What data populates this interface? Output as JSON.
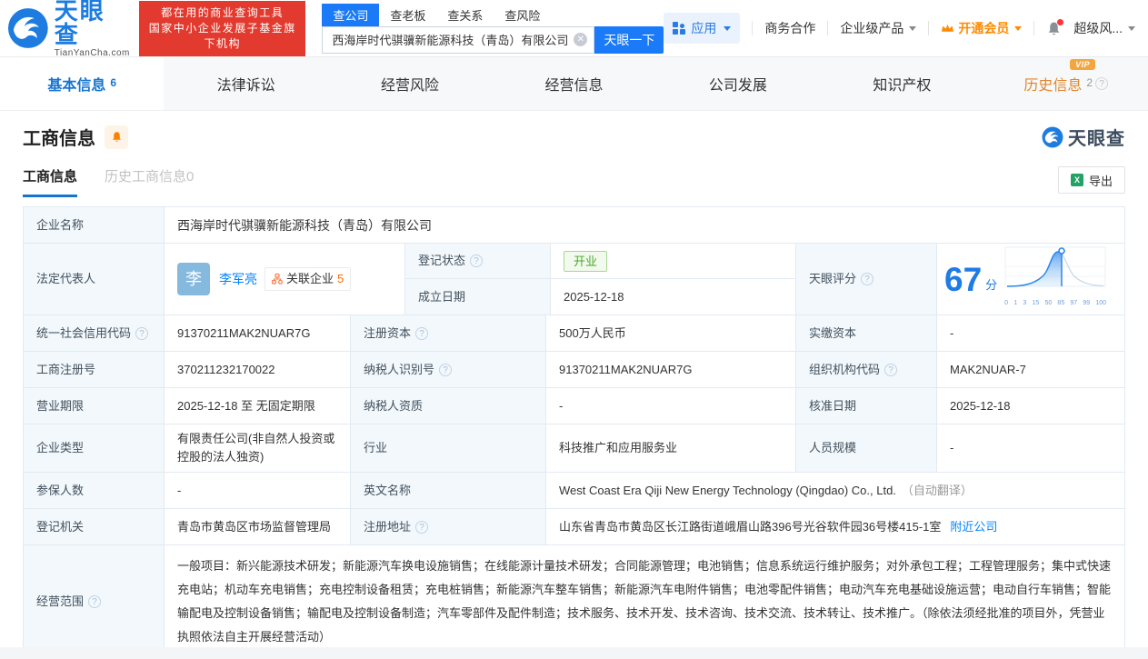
{
  "header": {
    "logo_title": "天眼查",
    "logo_domain": "TianYanCha.com",
    "slogan_line1": "都在用的商业查询工具",
    "slogan_line2": "国家中小企业发展子基金旗下机构",
    "search_tabs": {
      "company": "查公司",
      "boss": "查老板",
      "relation": "查关系",
      "risk": "查风险"
    },
    "search_value": "西海岸时代骐骥新能源科技（青岛）有限公司",
    "search_button": "天眼一下",
    "nav": {
      "apps": "应用",
      "cooperation": "商务合作",
      "enterprise": "企业级产品",
      "vip": "开通会员",
      "super_risk": "超级风..."
    }
  },
  "tabs": {
    "basic": "基本信息",
    "basic_count": "6",
    "legal": "法律诉讼",
    "biz_risk": "经营风险",
    "biz_info": "经营信息",
    "development": "公司发展",
    "ip": "知识产权",
    "history": "历史信息",
    "history_count": "2",
    "vip_badge": "VIP"
  },
  "section": {
    "title": "工商信息",
    "subtab_current": "工商信息",
    "subtab_history": "历史工商信息0",
    "export_label": "导出",
    "watermark": "天眼查"
  },
  "info": {
    "company_name_label": "企业名称",
    "company_name": "西海岸时代骐骥新能源科技（青岛）有限公司",
    "legal_rep_label": "法定代表人",
    "avatar_char": "李",
    "legal_rep_name": "李军亮",
    "related_label": "关联企业",
    "related_count": "5",
    "reg_status_label": "登记状态",
    "reg_status": "开业",
    "establish_label": "成立日期",
    "establish_date": "2025-12-18",
    "score_label": "天眼评分",
    "score": "67",
    "score_unit": "分",
    "score_ticks": [
      "0",
      "1",
      "3",
      "15",
      "50",
      "85",
      "97",
      "99",
      "100"
    ],
    "uscc_label": "统一社会信用代码",
    "uscc": "91370211MAK2NUAR7G",
    "reg_capital_label": "注册资本",
    "reg_capital": "500万人民币",
    "paid_capital_label": "实缴资本",
    "paid_capital": "-",
    "reg_number_label": "工商注册号",
    "reg_number": "370211232170022",
    "taxpayer_id_label": "纳税人识别号",
    "taxpayer_id": "91370211MAK2NUAR7G",
    "org_code_label": "组织机构代码",
    "org_code": "MAK2NUAR-7",
    "term_label": "营业期限",
    "term": "2025-12-18 至 无固定期限",
    "taxpayer_quality_label": "纳税人资质",
    "taxpayer_quality": "-",
    "approval_date_label": "核准日期",
    "approval_date": "2025-12-18",
    "company_type_label": "企业类型",
    "company_type": "有限责任公司(非自然人投资或控股的法人独资)",
    "industry_label": "行业",
    "industry": "科技推广和应用服务业",
    "staff_size_label": "人员规模",
    "staff_size": "-",
    "insured_label": "参保人数",
    "insured": "-",
    "english_name_label": "英文名称",
    "english_name": "West Coast Era Qiji New Energy Technology (Qingdao) Co., Ltd.",
    "auto_translate": "（自动翻译）",
    "authority_label": "登记机关",
    "authority": "青岛市黄岛区市场监督管理局",
    "address_label": "注册地址",
    "address": "山东省青岛市黄岛区长江路街道峨眉山路396号光谷软件园36号楼415-1室",
    "nearby_link": "附近公司",
    "scope_label": "经营范围",
    "scope": "一般项目：新兴能源技术研发；新能源汽车换电设施销售；在线能源计量技术研发；合同能源管理；电池销售；信息系统运行维护服务；对外承包工程；工程管理服务；集中式快速充电站；机动车充电销售；充电控制设备租赁；充电桩销售；新能源汽车整车销售；新能源汽车电附件销售；电池零配件销售；电动汽车充电基础设施运营；电动自行车销售；智能输配电及控制设备销售；输配电及控制设备制造；汽车零部件及配件制造；技术服务、技术开发、技术咨询、技术交流、技术转让、技术推广。（除依法须经批准的项目外，凭营业执照依法自主开展经营活动）"
  },
  "colors": {
    "brand_blue": "#1775d2",
    "link_blue": "#0084ff",
    "accent_orange": "#ff8a00",
    "status_green": "#49a82a",
    "banner_red": "#e23a2e"
  }
}
